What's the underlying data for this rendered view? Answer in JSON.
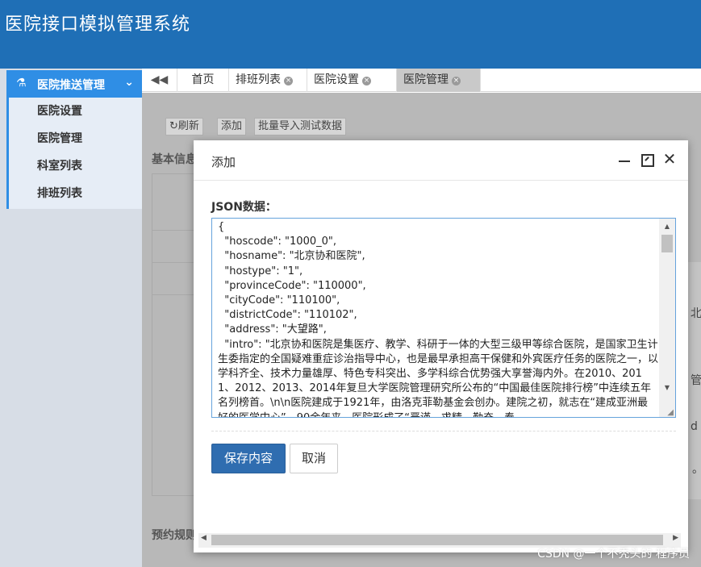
{
  "app": {
    "title": "医院接口模拟管理系统"
  },
  "sidebar": {
    "group_label": "医院推送管理",
    "items": [
      {
        "label": "医院设置"
      },
      {
        "label": "医院管理"
      },
      {
        "label": "科室列表"
      },
      {
        "label": "排班列表"
      }
    ]
  },
  "tabs": [
    {
      "label": "首页",
      "closable": false,
      "active": false
    },
    {
      "label": "排班列表",
      "closable": true,
      "active": false
    },
    {
      "label": "医院设置",
      "closable": true,
      "active": false
    },
    {
      "label": "医院管理",
      "closable": true,
      "active": true
    }
  ],
  "toolbar": {
    "refresh_label": "刷新",
    "add_label": "添加",
    "batch_import_label": "批量导入测试数据"
  },
  "background": {
    "basic_info_label": "基本信息",
    "booking_rules_label": "预约规则",
    "partial_chars": [
      "北",
      "管",
      "d",
      "。"
    ]
  },
  "modal": {
    "title": "添加",
    "json_label": "JSON数据：",
    "json_value": "{\n  \"hoscode\": \"1000_0\",\n  \"hosname\": \"北京协和医院\",\n  \"hostype\": \"1\",\n  \"provinceCode\": \"110000\",\n  \"cityCode\": \"110100\",\n  \"districtCode\": \"110102\",\n  \"address\": \"大望路\",\n  \"intro\": \"北京协和医院是集医疗、教学、科研于一体的大型三级甲等综合医院，是国家卫生计生委指定的全国疑难重症诊治指导中心，也是最早承担高干保健和外宾医疗任务的医院之一，以学科齐全、技术力量雄厚、特色专科突出、多学科综合优势强大享誉海内外。在2010、2011、2012、2013、2014年复旦大学医院管理研究所公布的“中国最佳医院排行榜”中连续五年名列榜首。\\n\\n医院建成于1921年，由洛克菲勒基金会创办。建院之初，就志在“建成亚洲最好的医学中心”。90余年来，医院形成了“严谨、求精、勤奋、奉",
    "save_label": "保存内容",
    "cancel_label": "取消"
  },
  "watermark": "CSDN @一个不秃头的 程序员",
  "colors": {
    "header_bg": "#1f6fb6",
    "sidebar_active": "#2f8ee5",
    "primary_button": "#2f6db0"
  }
}
